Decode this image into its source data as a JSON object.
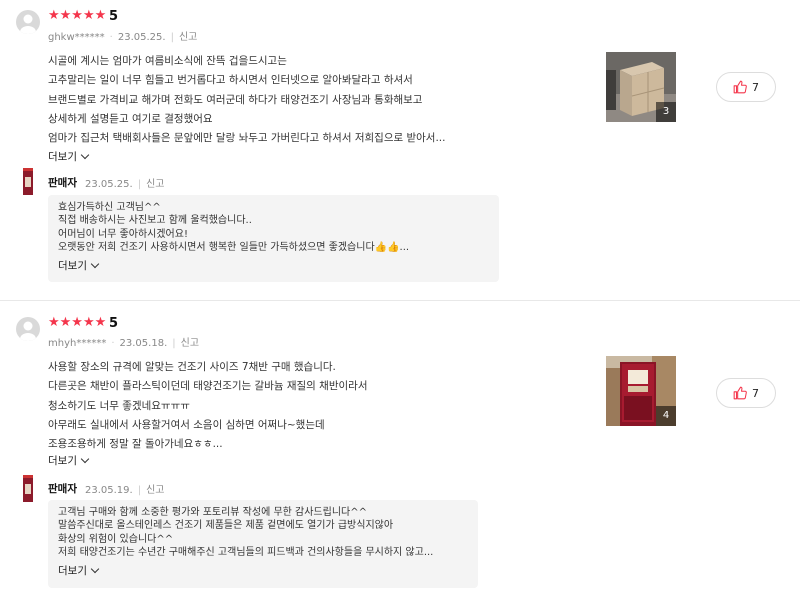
{
  "reviews": [
    {
      "stars": "★★★★★",
      "score": "5",
      "user": "ghkw******",
      "date": "23.05.25.",
      "report": "신고",
      "lines": [
        "시골에 계시는 엄마가 여름비소식에 잔뜩 겁을드시고는",
        "고추말리는 일이 너무 힘들고 번거롭다고 하시면서 인터넷으로 알아봐달라고 하셔서",
        "브랜드별로 가격비교 해가며 전화도 여러군데 하다가 태양건조기 사장님과 통화해보고",
        "상세하게 설명듣고 여기로 결정했어요",
        "엄마가 집근처 택배회사들은 문앞에만 달랑 놔두고 가버린다고 하셔서 저희집으로 받아서..."
      ],
      "more": "더보기",
      "photo_count": "3",
      "likes": "7",
      "seller": {
        "name": "판매자",
        "date": "23.05.25.",
        "report": "신고",
        "lines": [
          "효심가득하신 고객님^^",
          "직접 배송하시는 사진보고 함께 울컥했습니다..",
          "어머님이 너무 좋아하시겠어요!",
          "오랫동안 저희 건조기 사용하시면서 행복한 일들만 가득하셨으면 좋겠습니다👍👍..."
        ],
        "more": "더보기"
      }
    },
    {
      "stars": "★★★★★",
      "score": "5",
      "user": "mhyh******",
      "date": "23.05.18.",
      "report": "신고",
      "lines": [
        "사용할 장소의 규격에 알맞는 건조기 사이즈 7채반 구매 했습니다.",
        "다른곳은 채반이 플라스틱이던데 태양건조기는 갈바늄 재질의 채반이라서",
        "청소하기도 너무 좋겠네요ㅠㅠㅠ",
        "아무래도 실내에서 사용할거여서 소음이 심하면 어쩌나~했는데",
        "조용조용하게 정말 잘 돌아가네요ㅎㅎ..."
      ],
      "more": "더보기",
      "photo_count": "4",
      "likes": "7",
      "seller": {
        "name": "판매자",
        "date": "23.05.19.",
        "report": "신고",
        "lines": [
          "고객님 구매와 함께 소중한 평가와 포토리뷰 작성에 무한 감사드립니다^^",
          "말씀주신대로 올스테인레스 건조기 제품들은 제품 겉면에도 열기가 급방식지않아",
          "화상의 위험이 있습니다^^",
          "저희 태양건조기는 수년간 구매해주신 고객님들의 피드백과 건의사항들을 무시하지 않고..."
        ],
        "more": "더보기"
      }
    }
  ],
  "colors": {
    "star": "#f4364c",
    "like_icon": "#f4364c"
  }
}
